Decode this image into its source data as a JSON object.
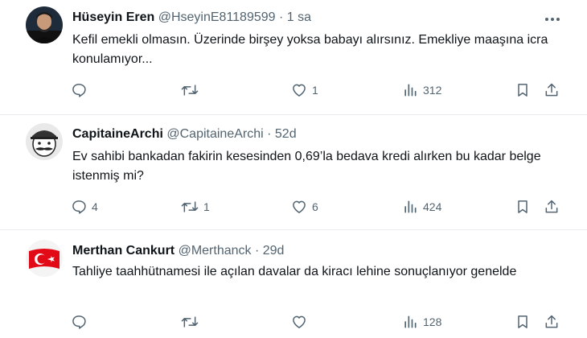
{
  "tweets": [
    {
      "name": "Hüseyin Eren",
      "handle": "@HseyinE81189599",
      "separator": "·",
      "time": "1 sa",
      "text": "Kefil emekli olmasın. Üzerinde birşey yoksa babayı alırsınız. Emekliye maaşına icra konulamıyor...",
      "replies": "",
      "retweets": "",
      "likes": "1",
      "views": "312",
      "avatar_icon": "profile-photo"
    },
    {
      "name": "CapitaineArchi",
      "handle": "@CapitaineArchi",
      "separator": "·",
      "time": "52d",
      "text": "Ev sahibi bankadan fakirin kesesinden 0,69’la bedava kredi alırken bu kadar belge istenmiş mi?",
      "replies": "4",
      "retweets": "1",
      "likes": "6",
      "views": "424",
      "avatar_icon": "cartoon-face"
    },
    {
      "name": "Merthan Cankurt",
      "handle": "@Merthanck",
      "separator": "·",
      "time": "29d",
      "text": "Tahliye taahhütnamesi ile açılan davalar da kiracı lehine sonuçlanıyor genelde",
      "replies": "",
      "retweets": "",
      "likes": "",
      "views": "128",
      "avatar_icon": "turkish-flag"
    }
  ],
  "colors": {
    "text": "#0f1419",
    "muted": "#536471",
    "divider": "#e8ecef",
    "flag_red": "#e30a17"
  }
}
